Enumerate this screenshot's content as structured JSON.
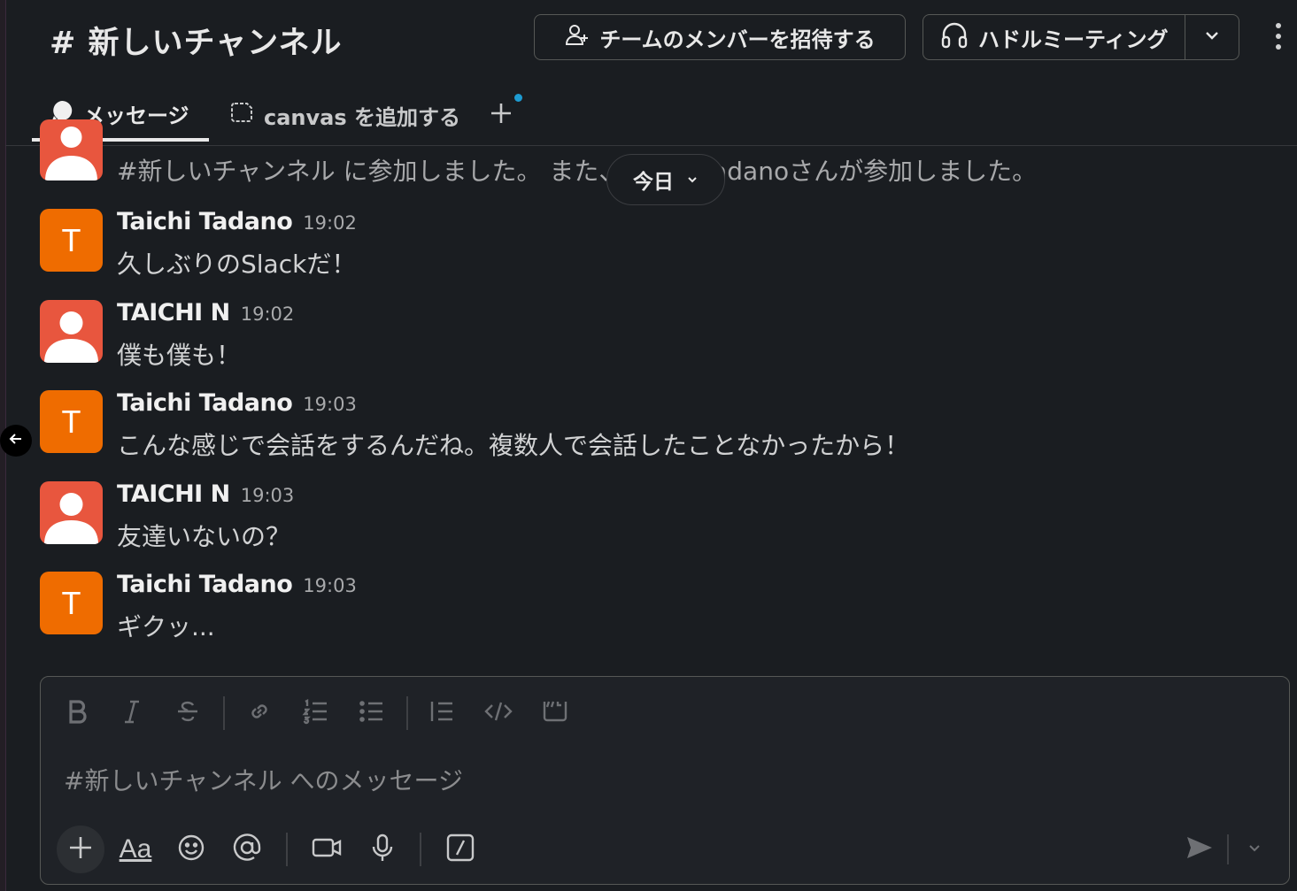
{
  "header": {
    "channel_title": "# 新しいチャンネル",
    "invite_label": "チームのメンバーを招待する",
    "huddle_label": "ハドルミーティング"
  },
  "tabs": [
    {
      "label": "メッセージ",
      "active": true
    },
    {
      "label": "canvas を追加する",
      "active": false
    }
  ],
  "system_message": "#新しいチャンネル に参加しました。 また、Taichi Tadanoさんが参加しました。",
  "date_divider": "今日",
  "messages": [
    {
      "author": "Taichi Tadano",
      "time": "19:02",
      "text": "久しぶりのSlackだ！",
      "avatar": "T"
    },
    {
      "author": "TAICHI N",
      "time": "19:02",
      "text": "僕も僕も！",
      "avatar": "person"
    },
    {
      "author": "Taichi Tadano",
      "time": "19:03",
      "text": "こんな感じで会話をするんだね。複数人で会話したことなかったから！",
      "avatar": "T"
    },
    {
      "author": "TAICHI N",
      "time": "19:03",
      "text": "友達いないの？",
      "avatar": "person"
    },
    {
      "author": "Taichi Tadano",
      "time": "19:03",
      "text": "ギクッ...",
      "avatar": "T"
    }
  ],
  "composer": {
    "placeholder": "#新しいチャンネル へのメッセージ",
    "format_label": "Aa"
  },
  "colors": {
    "background": "#1a1d21",
    "avatar_orange": "#ef6c00",
    "avatar_red": "#e8563e",
    "accent_blue": "#1d9bd1"
  },
  "icons": [
    "person-plus-icon",
    "headphones-icon",
    "chevron-down-icon",
    "more-vertical-icon",
    "message-bubble-icon",
    "canvas-icon",
    "plus-icon",
    "bold-icon",
    "italic-icon",
    "strikethrough-icon",
    "link-icon",
    "ordered-list-icon",
    "bullet-list-icon",
    "blockquote-icon",
    "code-icon",
    "code-block-icon",
    "emoji-icon",
    "mention-icon",
    "video-icon",
    "microphone-icon",
    "slash-command-icon",
    "send-icon",
    "arrow-left-icon"
  ]
}
